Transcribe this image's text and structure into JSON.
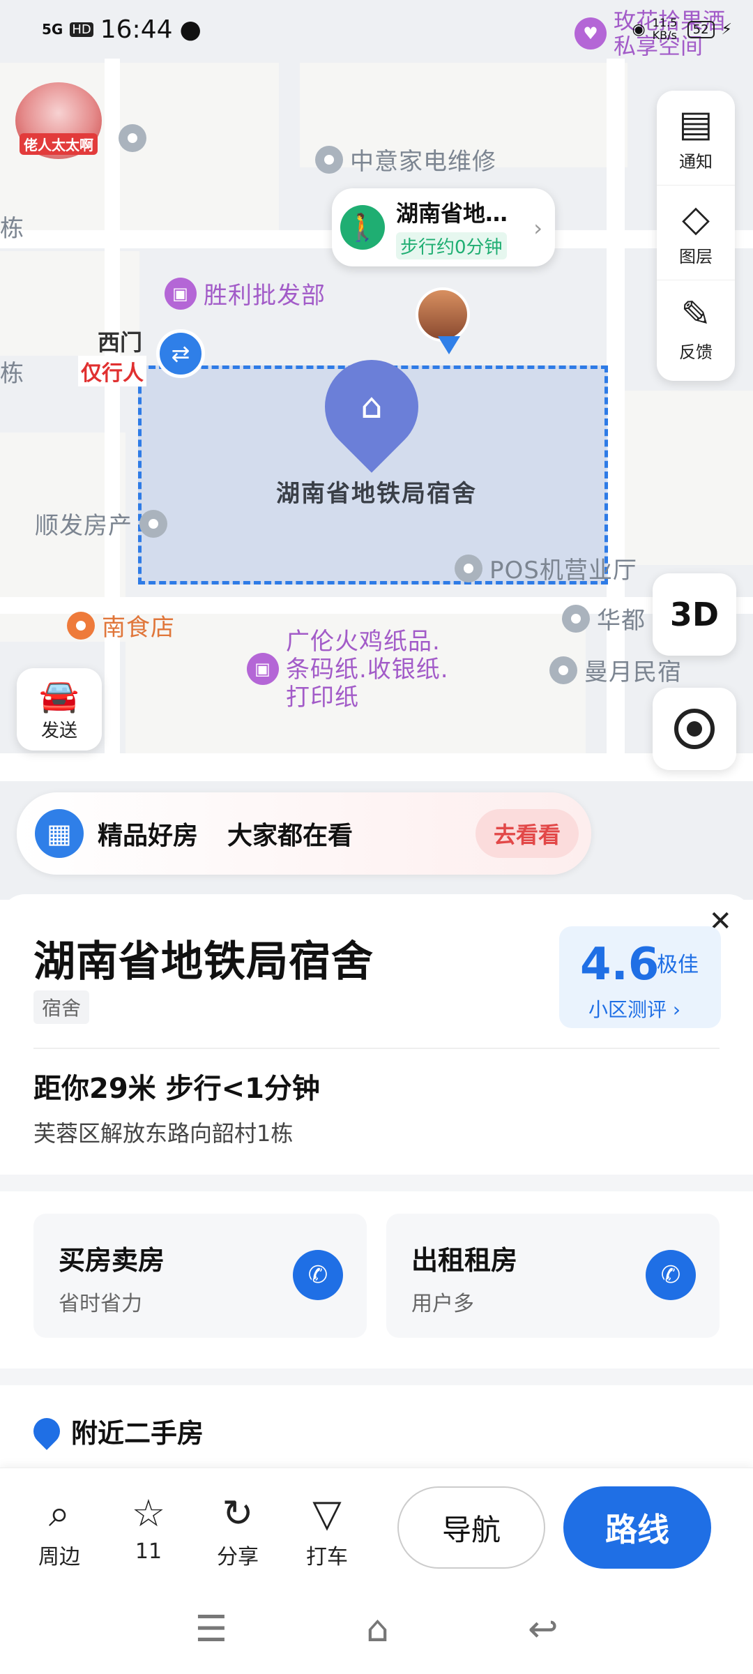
{
  "status_bar": {
    "network": "5G",
    "hd": "HD",
    "time": "16:44",
    "speed": "11.5 KB/s",
    "battery": "52",
    "poi_text": "玫花拾果酒 私享空间"
  },
  "map": {
    "avatar_tag": "佬人太太啊",
    "pois": {
      "zhongyi": "中意家电维修",
      "shengli": "胜利批发部",
      "shunfa": "顺发房产",
      "pos": "POS机营业厅",
      "nanshi": "南食店",
      "guanglun": "广伦火鸡纸品.条码纸.收银纸.打印纸",
      "huadu": "华都",
      "manyue": "曼月民宿",
      "dong": "栋",
      "dong2": "栋"
    },
    "west_gate": "西门",
    "pedestrian_only": "仅行人",
    "main_pin_label": "湖南省地铁局宿舍",
    "walk_card": {
      "title": "湖南省地…",
      "subtitle": "步行约0分钟"
    },
    "tools": [
      {
        "label": "通知",
        "icon": "notice-icon"
      },
      {
        "label": "图层",
        "icon": "layers-icon"
      },
      {
        "label": "反馈",
        "icon": "feedback-icon"
      }
    ],
    "btn_3d": "3D",
    "send_label": "发送"
  },
  "banner": {
    "title": "精品好房",
    "subtitle": "大家都在看",
    "button": "去看看"
  },
  "sheet": {
    "title": "湖南省地铁局宿舍",
    "tag": "宿舍",
    "rating": {
      "score": "4.6",
      "level": "极佳",
      "link": "小区测评 ›"
    },
    "distance": "距你29米 步行<1分钟",
    "address": "芙蓉区解放东路向韶村1栋",
    "services": [
      {
        "title": "买房卖房",
        "subtitle": "省时省力"
      },
      {
        "title": "出租租房",
        "subtitle": "用户多"
      }
    ],
    "nearby_title": "附近二手房"
  },
  "actions": [
    {
      "label": "周边",
      "icon": "search-icon"
    },
    {
      "label": "11",
      "icon": "star-icon"
    },
    {
      "label": "分享",
      "icon": "share-icon"
    },
    {
      "label": "打车",
      "icon": "taxi-icon"
    }
  ],
  "nav_button": "导航",
  "route_button": "路线",
  "colors": {
    "accent": "#1f6fe5",
    "purple_poi": "#a25bc8",
    "walk_green": "#1fae72",
    "banner_red": "#e24848"
  }
}
